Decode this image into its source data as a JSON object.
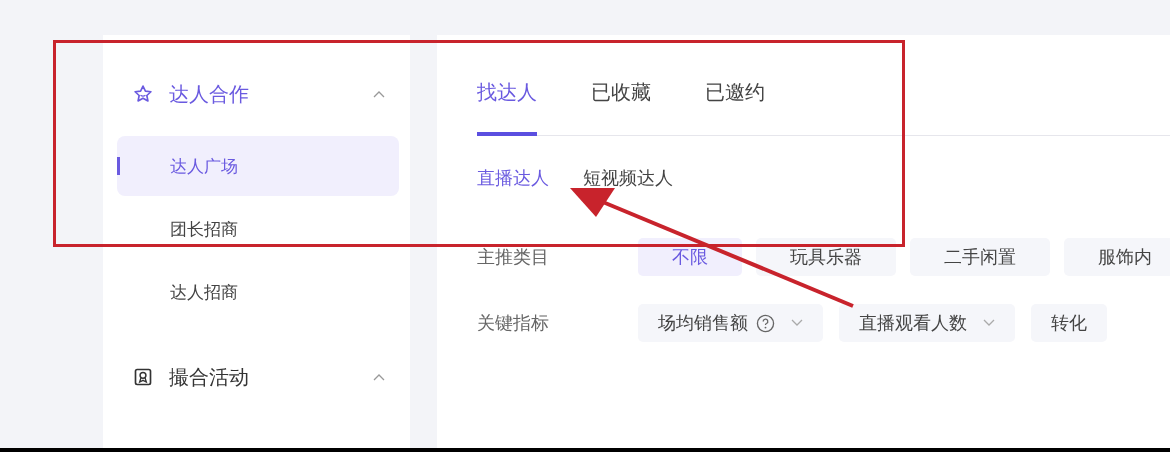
{
  "sidebar": {
    "groups": [
      {
        "kind": "star",
        "title": "达人合作",
        "expanded": true,
        "items": [
          {
            "label": "达人广场",
            "selected": true
          },
          {
            "label": "团长招商",
            "selected": false
          },
          {
            "label": "达人招商",
            "selected": false
          }
        ]
      },
      {
        "kind": "badge",
        "title": "撮合活动",
        "expanded": true
      }
    ]
  },
  "tabs": [
    {
      "label": "找达人",
      "selected": true
    },
    {
      "label": "已收藏",
      "selected": false
    },
    {
      "label": "已邀约",
      "selected": false
    }
  ],
  "subtabs": [
    {
      "label": "直播达人",
      "selected": true
    },
    {
      "label": "短视频达人",
      "selected": false
    }
  ],
  "filters": [
    {
      "label": "主推类目",
      "options": [
        {
          "label": "不限",
          "selected": true
        },
        {
          "label": "玩具乐器",
          "selected": false
        },
        {
          "label": "二手闲置",
          "selected": false
        },
        {
          "label": "服饰内",
          "selected": false
        }
      ]
    },
    {
      "label": "关键指标",
      "options": [
        {
          "label": "场均销售额",
          "help": true,
          "dropdown": true
        },
        {
          "label": "直播观看人数",
          "help": false,
          "dropdown": true
        },
        {
          "label": "转化",
          "help": false,
          "dropdown": false
        }
      ]
    }
  ],
  "annotations": {
    "frame": true,
    "arrow": true
  }
}
